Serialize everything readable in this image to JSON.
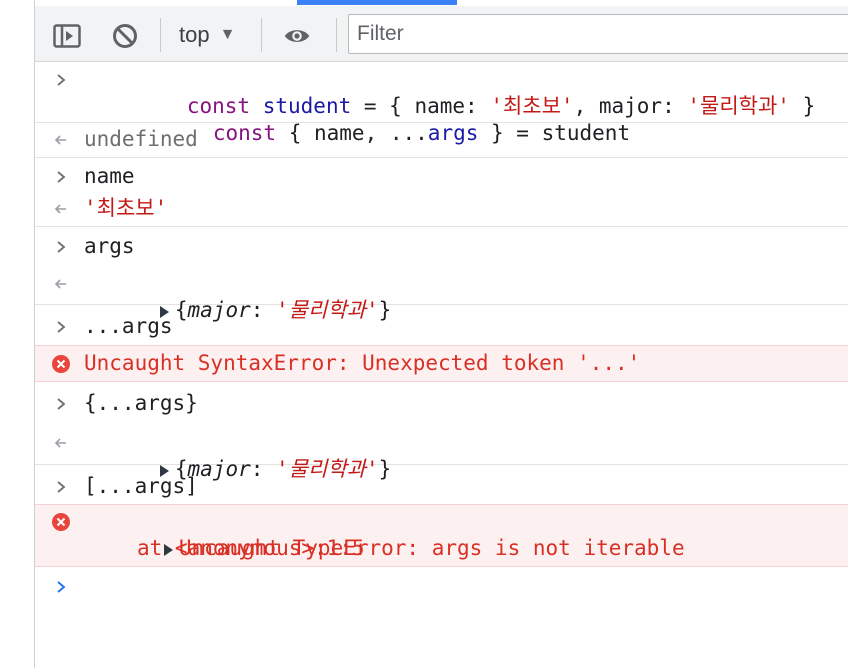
{
  "toolbar": {
    "context_label": "top",
    "context_arrow": "▼",
    "filter_placeholder": "Filter"
  },
  "icons": {
    "sidebar": "sidebar-toggle-icon",
    "clear": "clear-console-icon",
    "eye": "eye-icon",
    "input_prompt": "chevron-right-icon",
    "result": "result-arrow-icon",
    "error": "error-x-icon",
    "expand": "expand-triangle-icon"
  },
  "colors": {
    "keyword": "#881280",
    "variable": "#1a1aa6",
    "string": "#c41a16",
    "error": "#d93025",
    "error_bg": "#fdf0f0",
    "prompt": "#1a73e8"
  },
  "console": {
    "e1": {
      "l1": {
        "kw": "const",
        "var": "student",
        "p1": " = { name: ",
        "s1": "'최초보'",
        "p2": ", major: ",
        "s2": "'물리학과'",
        "p3": " }"
      },
      "l2": {
        "kw": "const",
        "p1": " { name, ...",
        "var": "args",
        "p2": " } = student"
      },
      "result": "undefined"
    },
    "e2": {
      "input": "name",
      "result": "'최초보'"
    },
    "e3": {
      "input": "args",
      "key": "major",
      "colon": ": ",
      "val": "'물리학과'",
      "open": "{",
      "close": "}"
    },
    "e4": {
      "input": "...args",
      "error": "Uncaught SyntaxError: Unexpected token '...'"
    },
    "e5": {
      "input": "{...args}",
      "key": "major",
      "colon": ": ",
      "val": "'물리학과'",
      "open": "{",
      "close": "}"
    },
    "e6": {
      "input": "[...args]",
      "error": "Uncaught TypeError: args is not iterable",
      "trace": "at <anonymous>:1:5"
    }
  }
}
